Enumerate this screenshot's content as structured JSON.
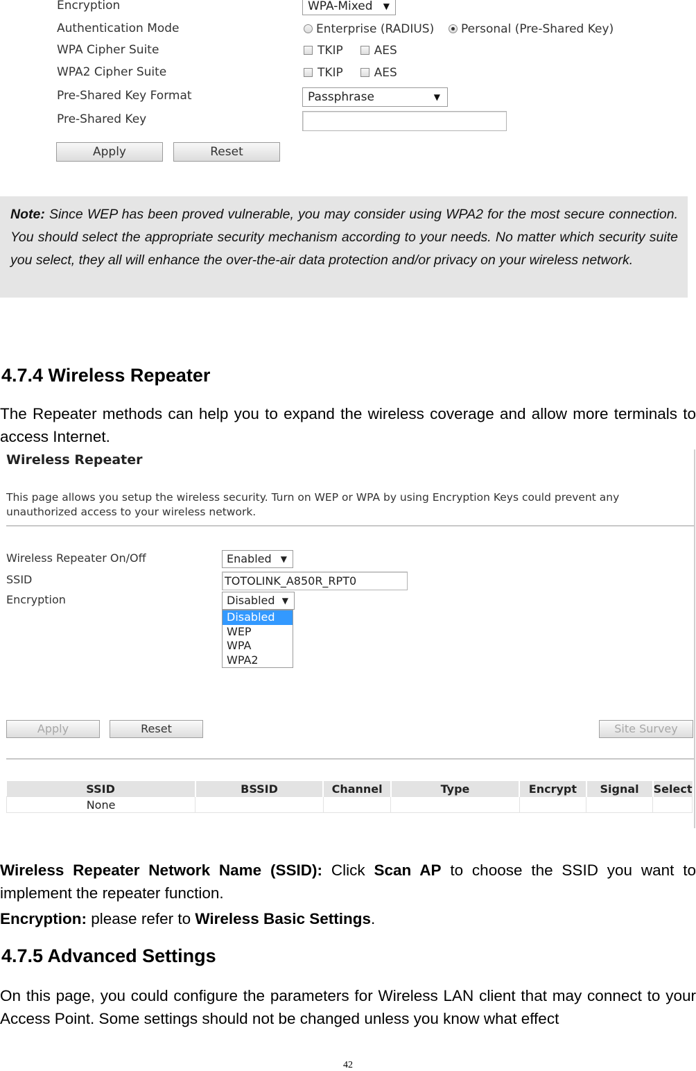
{
  "security_form": {
    "encryption_label": "Encryption",
    "encryption_value": "WPA-Mixed",
    "auth_mode_label": "Authentication Mode",
    "auth_enterprise": "Enterprise (RADIUS)",
    "auth_personal": "Personal (Pre-Shared Key)",
    "wpa_cipher_label": "WPA Cipher Suite",
    "wpa2_cipher_label": "WPA2 Cipher Suite",
    "tkip": "TKIP",
    "aes": "AES",
    "psk_format_label": "Pre-Shared Key Format",
    "psk_format_value": "Passphrase",
    "psk_label": "Pre-Shared Key",
    "psk_value": "",
    "apply": "Apply",
    "reset": "Reset"
  },
  "note": {
    "lead": "Note:",
    "text": " Since WEP has been proved vulnerable, you may consider using WPA2 for the most secure connection. You should select the appropriate security mechanism according to your needs. No matter which security suite you select, they all will enhance the over-the-air data protection and/or privacy on your wireless network."
  },
  "section_474": {
    "heading": "4.7.4 Wireless Repeater",
    "intro": "The Repeater methods can help you to expand the wireless coverage and allow more terminals to access Internet."
  },
  "repeater_ui": {
    "title": "Wireless Repeater",
    "description": "This page allows you setup the wireless security. Turn on WEP or WPA by using Encryption Keys could prevent any unauthorized access to your wireless network.",
    "onoff_label": "Wireless Repeater On/Off",
    "onoff_value": "Enabled",
    "ssid_label": "SSID",
    "ssid_value": "TOTOLINK_A850R_RPT0",
    "encryption_label": "Encryption",
    "encryption_value": "Disabled",
    "encryption_options": [
      "Disabled",
      "WEP",
      "WPA",
      "WPA2"
    ],
    "apply": "Apply",
    "reset": "Reset",
    "site_survey": "Site Survey",
    "table_headers": [
      "SSID",
      "BSSID",
      "Channel",
      "Type",
      "Encrypt",
      "Signal",
      "Select"
    ],
    "table_rows": [
      [
        "None",
        "",
        "",
        "",
        "",
        "",
        ""
      ]
    ]
  },
  "descriptions": {
    "ssid_term": "Wireless Repeater Network Name (SSID):",
    "ssid_pre": " Click ",
    "ssid_bold": "Scan AP",
    "ssid_post": " to choose the SSID you want to implement the repeater function.",
    "enc_term": "Encryption:",
    "enc_pre": " please refer to ",
    "enc_bold": "Wireless Basic Settings",
    "enc_post": "."
  },
  "section_475": {
    "heading": "4.7.5 Advanced Settings",
    "text": "On this page, you could configure the parameters for Wireless LAN client that may connect to your Access Point. Some settings should not be changed unless you know what effect"
  },
  "page_number": "42"
}
